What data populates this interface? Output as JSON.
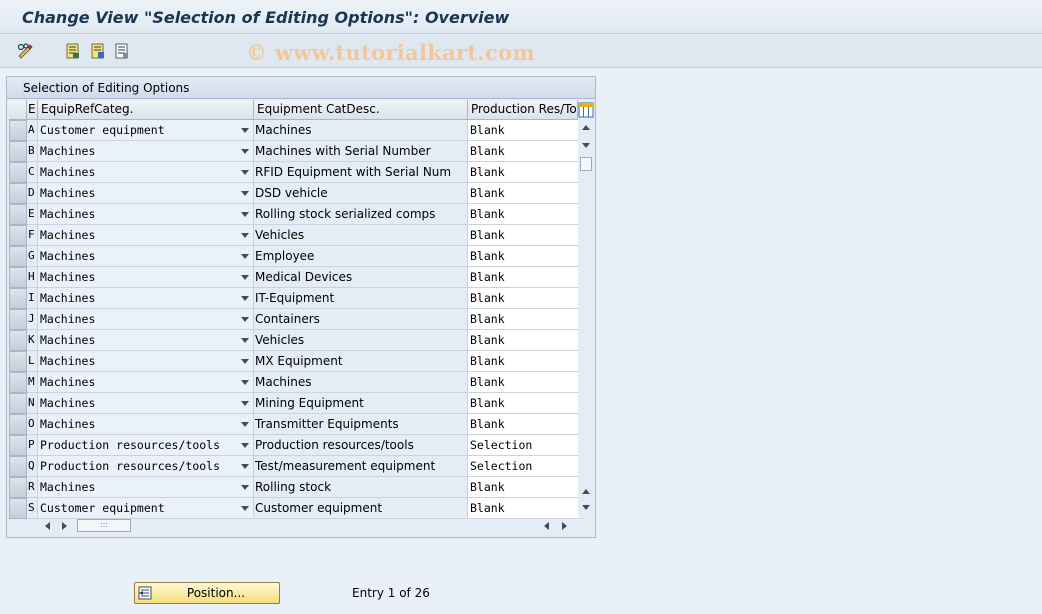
{
  "window": {
    "title": "Change View \"Selection of Editing Options\": Overview"
  },
  "watermark": "© www.tutorialkart.com",
  "toolbar": {
    "icons": [
      "edit-glasses-icon",
      "save-list-icon",
      "export-icon",
      "details-icon"
    ]
  },
  "panel": {
    "title": "Selection of Editing Options"
  },
  "table": {
    "columns": [
      "E",
      "EquipRefCateg.",
      "Equipment CatDesc.",
      "Production Res/Too"
    ],
    "rows": [
      {
        "key": "A",
        "category": "Customer equipment",
        "desc": "Machines",
        "res": "Blank"
      },
      {
        "key": "B",
        "category": "Machines",
        "desc": "Machines with Serial Number",
        "res": "Blank"
      },
      {
        "key": "C",
        "category": "Machines",
        "desc": "RFID Equipment with Serial Num",
        "res": "Blank"
      },
      {
        "key": "D",
        "category": "Machines",
        "desc": "DSD vehicle",
        "res": "Blank"
      },
      {
        "key": "E",
        "category": "Machines",
        "desc": "Rolling stock serialized comps",
        "res": "Blank"
      },
      {
        "key": "F",
        "category": "Machines",
        "desc": "Vehicles",
        "res": "Blank"
      },
      {
        "key": "G",
        "category": "Machines",
        "desc": "Employee",
        "res": "Blank"
      },
      {
        "key": "H",
        "category": "Machines",
        "desc": "Medical Devices",
        "res": "Blank"
      },
      {
        "key": "I",
        "category": "Machines",
        "desc": "IT-Equipment",
        "res": "Blank"
      },
      {
        "key": "J",
        "category": "Machines",
        "desc": "Containers",
        "res": "Blank"
      },
      {
        "key": "K",
        "category": "Machines",
        "desc": "Vehicles",
        "res": "Blank"
      },
      {
        "key": "L",
        "category": "Machines",
        "desc": "MX Equipment",
        "res": "Blank"
      },
      {
        "key": "M",
        "category": "Machines",
        "desc": "Machines",
        "res": "Blank"
      },
      {
        "key": "N",
        "category": "Machines",
        "desc": "Mining Equipment",
        "res": "Blank"
      },
      {
        "key": "O",
        "category": "Machines",
        "desc": "Transmitter Equipments",
        "res": "Blank"
      },
      {
        "key": "P",
        "category": "Production resources/tools",
        "desc": "Production resources/tools",
        "res": "Selection"
      },
      {
        "key": "Q",
        "category": "Production resources/tools",
        "desc": "Test/measurement equipment",
        "res": "Selection"
      },
      {
        "key": "R",
        "category": "Machines",
        "desc": "Rolling stock",
        "res": "Blank"
      },
      {
        "key": "S",
        "category": "Customer equipment",
        "desc": "Customer equipment",
        "res": "Blank"
      }
    ]
  },
  "footer": {
    "position_label": "Position...",
    "entry_text": "Entry 1 of 26"
  }
}
